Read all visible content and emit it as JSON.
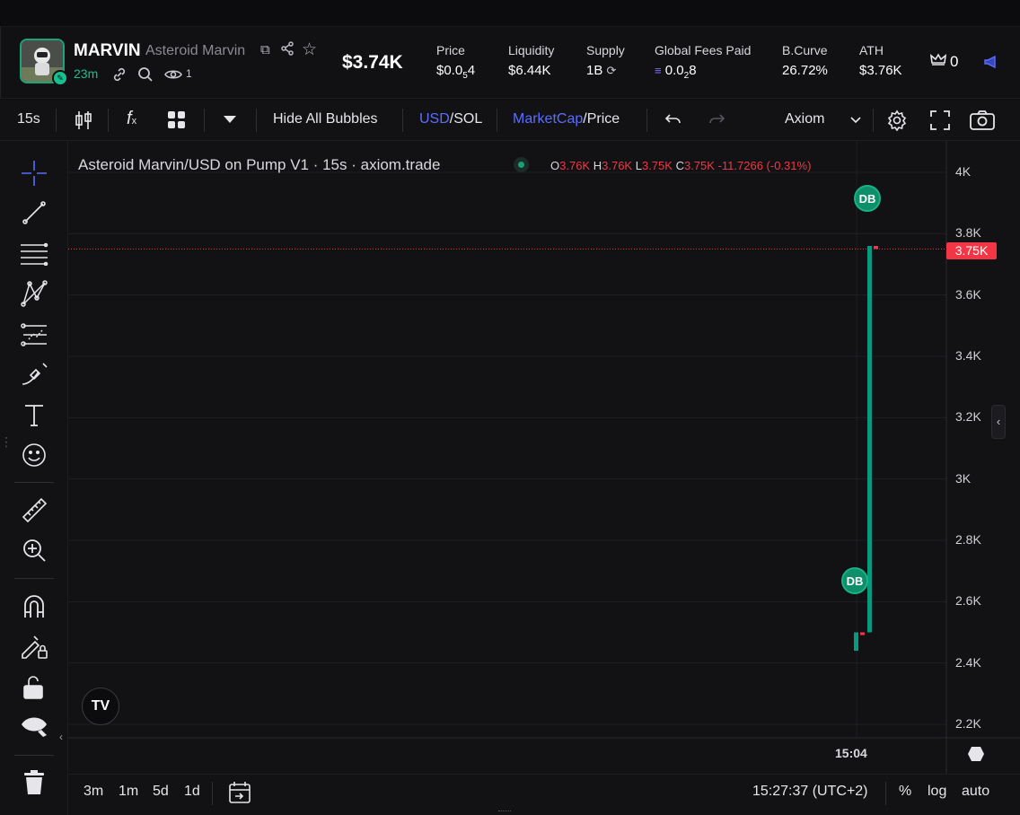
{
  "header": {
    "symbol": "MARVIN",
    "name": "Asteroid Marvin",
    "age": "23m",
    "watchers": "1",
    "market_cap": "$3.74K",
    "stats": [
      {
        "label": "Price",
        "value_main": "$0.0",
        "value_sub": "5",
        "value_tail": "4"
      },
      {
        "label": "Liquidity",
        "value": "$6.44K"
      },
      {
        "label": "Supply",
        "value": "1B"
      },
      {
        "label": "Global Fees Paid",
        "value_main": "0.0",
        "value_sub": "2",
        "value_tail": "8"
      },
      {
        "label": "B.Curve",
        "value": "26.72%"
      },
      {
        "label": "ATH",
        "value": "$3.76K"
      }
    ],
    "crown_count": "0"
  },
  "toolbar": {
    "interval": "15s",
    "hide_bubbles": "Hide All Bubbles",
    "currency_active": "USD",
    "currency_other": "/SOL",
    "mode_active": "MarketCap",
    "mode_other": "/Price",
    "source": "Axiom"
  },
  "chart": {
    "legend": "Asteroid Marvin/USD on Pump V1 · 15s · axiom.trade",
    "ohlc": {
      "o_label": "O",
      "o": "3.76K",
      "h_label": "H",
      "h": "3.76K",
      "l_label": "L",
      "l": "3.75K",
      "c_label": "C",
      "c": "3.75K",
      "change": "-11.7266 (-0.31%)"
    },
    "price_tag": "3.75K",
    "time_label": "15:04",
    "bubble_label": "DB",
    "logo": "TV"
  },
  "chart_data": {
    "type": "candlestick",
    "y_ticks": [
      "4K",
      "3.8K",
      "3.6K",
      "3.4K",
      "3.2K",
      "3K",
      "2.8K",
      "2.6K",
      "2.4K",
      "2.2K"
    ],
    "ylim": [
      2150,
      4100
    ],
    "x_ticks": [
      "15:04"
    ],
    "last_price": 3750,
    "candles": [
      {
        "o": 2500,
        "h": 2500,
        "l": 2440,
        "c": 2440,
        "color": "green"
      },
      {
        "o": 2500,
        "h": 2500,
        "l": 2500,
        "c": 2500,
        "color": "red"
      },
      {
        "o": 2500,
        "h": 3760,
        "l": 2500,
        "c": 3760,
        "color": "green"
      },
      {
        "o": 3760,
        "h": 3760,
        "l": 3750,
        "c": 3750,
        "color": "red"
      }
    ],
    "markers": [
      {
        "label": "DB",
        "value": 3930
      },
      {
        "label": "DB",
        "value": 2670
      }
    ]
  },
  "bottom": {
    "ranges": [
      "3m",
      "1m",
      "5d",
      "1d"
    ],
    "clock": "15:27:37 (UTC+2)",
    "percent": "%",
    "log": "log",
    "auto": "auto"
  },
  "colors": {
    "up": "#089981",
    "down": "#f23645",
    "accent": "#5b6dff",
    "green": "#18c08f"
  }
}
